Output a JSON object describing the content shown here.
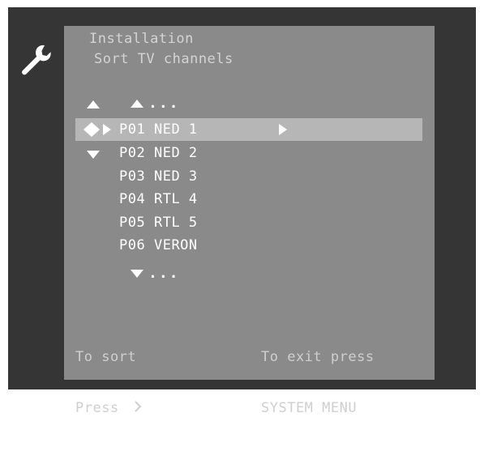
{
  "app": {
    "icon": "wrench-icon"
  },
  "header": {
    "title": "Installation",
    "subtitle": "Sort TV channels"
  },
  "list": {
    "more_above": "...",
    "more_below": "...",
    "selected_index": 0,
    "items": [
      {
        "number": "P01",
        "name": "NED 1"
      },
      {
        "number": "P02",
        "name": "NED 2"
      },
      {
        "number": "P03",
        "name": "NED 3"
      },
      {
        "number": "P04",
        "name": "RTL 4"
      },
      {
        "number": "P05",
        "name": "RTL 5"
      },
      {
        "number": "P06",
        "name": "VERON"
      }
    ]
  },
  "hints": {
    "sort_line1": "To sort",
    "sort_line2": "Press",
    "exit_line1": "To exit press",
    "exit_line2": "SYSTEM MENU"
  },
  "colors": {
    "frame": "#353535",
    "panel": "#8a8a8a",
    "highlight": "#b6b6b6",
    "text": "#ffffff"
  }
}
